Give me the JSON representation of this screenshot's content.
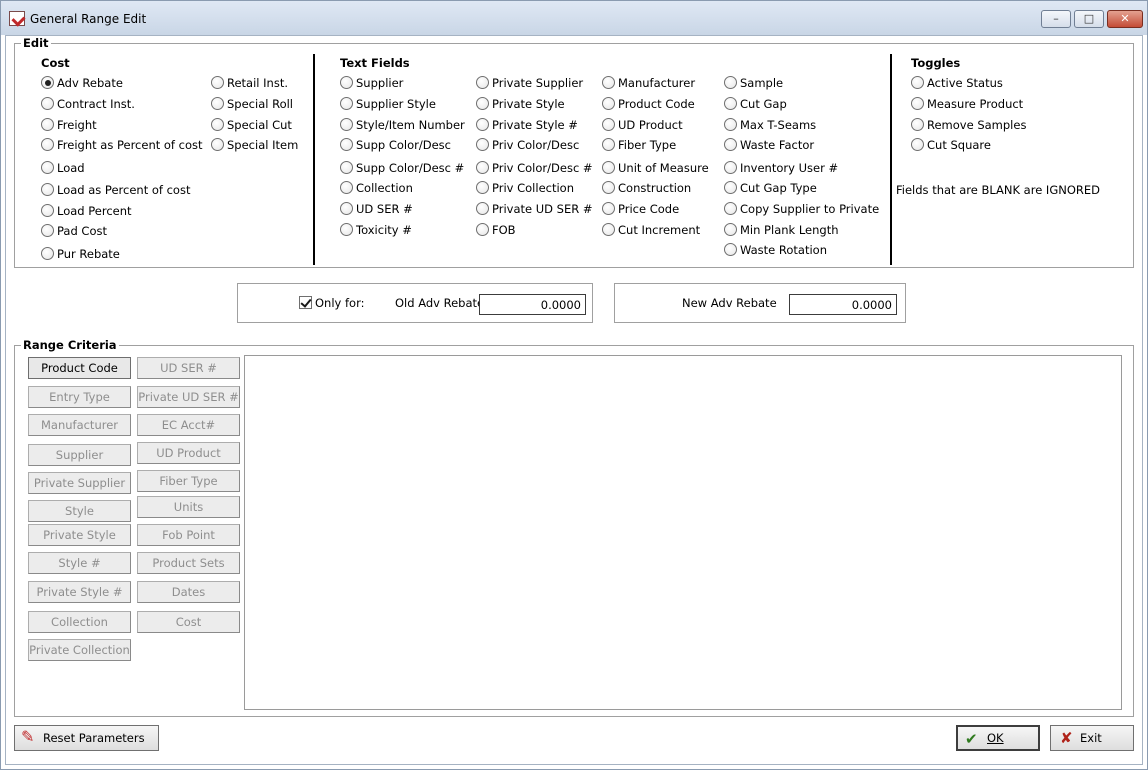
{
  "window": {
    "title": "General Range Edit"
  },
  "edit": {
    "legend": "Edit",
    "cost": {
      "title": "Cost",
      "col1": [
        "Adv Rebate",
        "Contract Inst.",
        "Freight",
        "Freight as Percent of cost",
        "Load",
        "Load as Percent of cost",
        "Load Percent",
        "Pad Cost",
        "Pur Rebate"
      ],
      "col2": [
        "Retail Inst.",
        "Special Roll",
        "Special Cut",
        "Special Item"
      ],
      "selected": "Adv Rebate"
    },
    "text_fields": {
      "title": "Text Fields",
      "col1": [
        "Supplier",
        "Supplier Style",
        "Style/Item Number",
        "Supp Color/Desc",
        "Supp Color/Desc #",
        "Collection",
        "UD SER #",
        "Toxicity #"
      ],
      "col2": [
        "Private Supplier",
        "Private Style",
        "Private Style #",
        "Priv Color/Desc",
        "Priv Color/Desc #",
        "Priv Collection",
        "Private UD SER #",
        "FOB"
      ],
      "col3": [
        "Manufacturer",
        "Product Code",
        "UD Product",
        "Fiber Type",
        "Unit of Measure",
        "Construction",
        "Price Code",
        "Cut Increment"
      ],
      "col4": [
        "Sample",
        "Cut Gap",
        "Max T-Seams",
        "Waste Factor",
        "Inventory User #",
        "Cut Gap Type",
        "Copy Supplier to Private",
        "Min Plank Length",
        "Waste Rotation"
      ]
    },
    "toggles": {
      "title": "Toggles",
      "items": [
        "Active Status",
        "Measure Product",
        "Remove Samples",
        "Cut Square"
      ],
      "note": "Fields that are BLANK are IGNORED"
    }
  },
  "values": {
    "only_for_label": "Only for:",
    "only_for_checked": true,
    "old_label": "Old Adv Rebate",
    "old_value": "0.0000",
    "new_label": "New Adv Rebate",
    "new_value": "0.0000"
  },
  "range": {
    "legend": "Range Criteria",
    "col1": [
      "Product Code",
      "Entry Type",
      "Manufacturer",
      "Supplier",
      "Private Supplier",
      "Style",
      "Private Style",
      "Style #",
      "Private Style #",
      "Collection",
      "Private Collection"
    ],
    "col2": [
      "UD SER #",
      "Private UD SER #",
      "EC Acct#",
      "UD Product",
      "Fiber Type",
      "Units",
      "Fob Point",
      "Product Sets",
      "Dates",
      "Cost"
    ],
    "active": "Product Code"
  },
  "buttons": {
    "reset": "Reset Parameters",
    "ok": "OK",
    "exit": "Exit"
  }
}
